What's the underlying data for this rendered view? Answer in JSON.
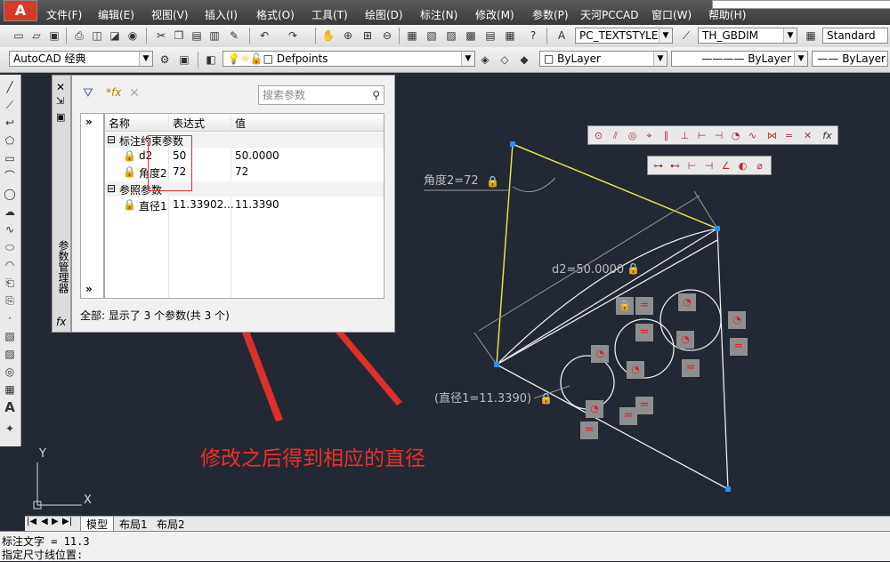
{
  "app": {
    "logo": "A"
  },
  "menu": [
    "文件(F)",
    "编辑(E)",
    "视图(V)",
    "插入(I)",
    "格式(O)",
    "工具(T)",
    "绘图(D)",
    "标注(N)",
    "修改(M)",
    "参数(P)",
    "天河PCCAD",
    "窗口(W)",
    "帮助(H)"
  ],
  "toolbar1": {
    "text_style": "PC_TEXTSTYLE",
    "dim_style": "TH_GBDIM",
    "table_style": "Standard"
  },
  "toolbar2": {
    "workspace": "AutoCAD 经典",
    "layer": "Defpoints",
    "color": "ByLayer",
    "linetype": "ByLayer",
    "lineweight": "ByLayer"
  },
  "param_manager": {
    "palette_title": "参数管理器",
    "fx_label": "fx",
    "search_placeholder": "搜索参数",
    "expand_label": "»",
    "columns": [
      "名称",
      "表达式",
      "值"
    ],
    "groups": [
      {
        "name": "标注约束参数",
        "rows": [
          {
            "name": "d2",
            "expression": "50",
            "value": "50.0000"
          },
          {
            "name": "角度2",
            "expression": "72",
            "value": "72"
          }
        ]
      },
      {
        "name": "参照参数",
        "rows": [
          {
            "name": "直径1",
            "expression": "11.33902...",
            "value": "11.3390"
          }
        ]
      }
    ],
    "status": "全部: 显示了 3 个参数(共 3 个)"
  },
  "drawing": {
    "angle_label": "角度2=72",
    "d2_label": "d2=50.0000",
    "diameter_label": "(直径1=11.3390)",
    "ucs_x": "X",
    "ucs_y": "Y",
    "eq_symbol": "="
  },
  "annotation_text": "修改之后得到相应的直径",
  "layout_tabs": [
    "模型",
    "布局1",
    "布局2"
  ],
  "command_lines": [
    "标注文字 = 11.3",
    "指定尺寸线位置:"
  ]
}
